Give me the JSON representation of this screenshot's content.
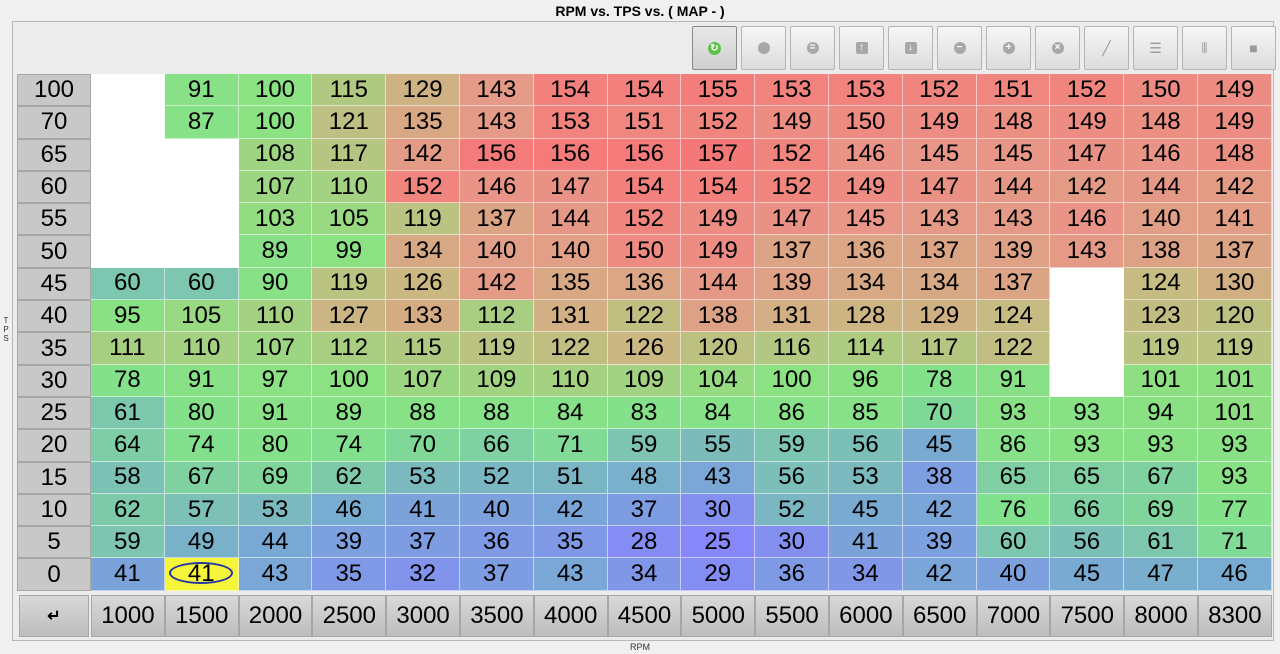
{
  "title": "RPM vs. TPS vs. ( MAP -   )",
  "y_axis_label": "T\nP\nS",
  "x_axis_label": "RPM",
  "corner_icon": "↵",
  "toolbar": [
    {
      "name": "refresh-icon",
      "glyph": "↻",
      "style": "green"
    },
    {
      "name": "circle-icon",
      "glyph": "",
      "style": "circle"
    },
    {
      "name": "equals-icon",
      "glyph": "=",
      "style": "circle"
    },
    {
      "name": "arrow-up-icon",
      "glyph": "↑",
      "style": "sq"
    },
    {
      "name": "arrow-down-icon",
      "glyph": "↓",
      "style": "sq"
    },
    {
      "name": "minus-icon",
      "glyph": "−",
      "style": "circle"
    },
    {
      "name": "plus-icon",
      "glyph": "+",
      "style": "circle"
    },
    {
      "name": "close-icon",
      "glyph": "×",
      "style": "circle"
    },
    {
      "name": "pencil-icon",
      "glyph": "╱",
      "style": "plain"
    },
    {
      "name": "rows-icon",
      "glyph": "☰",
      "style": "plain"
    },
    {
      "name": "columns-icon",
      "glyph": "⦀",
      "style": "plain"
    },
    {
      "name": "block-icon",
      "glyph": "■",
      "style": "plain"
    }
  ],
  "rpm": [
    "1000",
    "1500",
    "2000",
    "2500",
    "3000",
    "3500",
    "4000",
    "4500",
    "5000",
    "5500",
    "6000",
    "6500",
    "7000",
    "7500",
    "8000",
    "8300"
  ],
  "tps": [
    "100",
    "70",
    "65",
    "60",
    "55",
    "50",
    "45",
    "40",
    "35",
    "30",
    "25",
    "20",
    "15",
    "10",
    "5",
    "0"
  ],
  "selected_cell": {
    "row": 15,
    "col": 1
  },
  "table": [
    [
      null,
      91,
      100,
      115,
      129,
      143,
      154,
      154,
      155,
      153,
      153,
      152,
      151,
      152,
      150,
      149
    ],
    [
      null,
      87,
      100,
      121,
      135,
      143,
      153,
      151,
      152,
      149,
      150,
      149,
      148,
      149,
      148,
      149
    ],
    [
      null,
      null,
      108,
      117,
      142,
      156,
      156,
      156,
      157,
      152,
      146,
      145,
      145,
      147,
      146,
      148
    ],
    [
      null,
      null,
      107,
      110,
      152,
      146,
      147,
      154,
      154,
      152,
      149,
      147,
      144,
      142,
      144,
      142
    ],
    [
      null,
      null,
      103,
      105,
      119,
      137,
      144,
      152,
      149,
      147,
      145,
      143,
      143,
      146,
      140,
      141
    ],
    [
      null,
      null,
      89,
      99,
      134,
      140,
      140,
      150,
      149,
      137,
      136,
      137,
      139,
      143,
      138,
      137
    ],
    [
      60,
      60,
      90,
      119,
      126,
      142,
      135,
      136,
      144,
      139,
      134,
      134,
      137,
      null,
      124,
      130
    ],
    [
      95,
      105,
      110,
      127,
      133,
      112,
      131,
      122,
      138,
      131,
      128,
      129,
      124,
      null,
      123,
      120
    ],
    [
      111,
      110,
      107,
      112,
      115,
      119,
      122,
      126,
      120,
      116,
      114,
      117,
      122,
      null,
      119,
      119
    ],
    [
      78,
      91,
      97,
      100,
      107,
      109,
      110,
      109,
      104,
      100,
      96,
      78,
      91,
      null,
      101,
      101
    ],
    [
      61,
      80,
      91,
      89,
      88,
      88,
      84,
      83,
      84,
      86,
      85,
      70,
      93,
      93,
      94,
      101
    ],
    [
      64,
      74,
      80,
      74,
      70,
      66,
      71,
      59,
      55,
      59,
      56,
      45,
      86,
      93,
      93,
      93
    ],
    [
      58,
      67,
      69,
      62,
      53,
      52,
      51,
      48,
      43,
      56,
      53,
      38,
      65,
      65,
      67,
      93
    ],
    [
      62,
      57,
      53,
      46,
      41,
      40,
      42,
      37,
      30,
      52,
      45,
      42,
      76,
      66,
      69,
      77
    ],
    [
      59,
      49,
      44,
      39,
      37,
      36,
      35,
      28,
      25,
      30,
      41,
      39,
      60,
      56,
      61,
      71
    ],
    [
      41,
      41,
      43,
      35,
      32,
      37,
      43,
      34,
      29,
      36,
      34,
      42,
      40,
      45,
      47,
      46
    ]
  ]
}
